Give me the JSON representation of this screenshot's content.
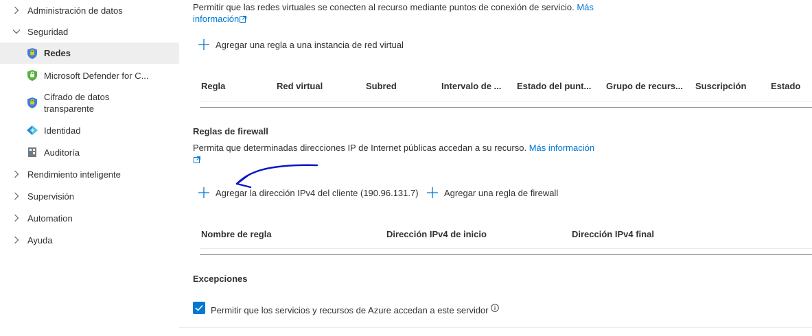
{
  "sidebar": {
    "items": [
      {
        "label": "Administración de datos"
      },
      {
        "label": "Seguridad"
      },
      {
        "label": "Redes"
      },
      {
        "label": "Microsoft Defender for C..."
      },
      {
        "label_line1": "Cifrado de datos",
        "label_line2": "transparente"
      },
      {
        "label": "Identidad"
      },
      {
        "label": "Auditoría"
      },
      {
        "label": "Rendimiento inteligente"
      },
      {
        "label": "Supervisión"
      },
      {
        "label": "Automation"
      },
      {
        "label": "Ayuda"
      }
    ],
    "icons": {
      "chevron_right": "chevron-right-icon",
      "chevron_down": "chevron-down-icon",
      "shield": "shield-icon",
      "defender": "defender-shield-icon",
      "identity": "identity-diamond-icon",
      "audit": "audit-building-icon"
    }
  },
  "vnet": {
    "description": "Permitir que las redes virtuales se conecten al recurso mediante puntos de conexión de servicio.",
    "more_info_1": "Más",
    "more_info_2": "información",
    "add_label": "Agregar una regla a una instancia de red virtual",
    "columns": [
      "Regla",
      "Red virtual",
      "Subred",
      "Intervalo de ...",
      "Estado del punt...",
      "Grupo de recurs...",
      "Suscripción",
      "Estado"
    ]
  },
  "firewall": {
    "title": "Reglas de firewall",
    "description": "Permita que determinadas direcciones IP de Internet públicas accedan a su recurso.",
    "more_info": "Más información",
    "add_client_label": "Agregar la dirección IPv4 del cliente (190.96.131.7)",
    "add_rule_label": "Agregar una regla de firewall",
    "columns": [
      "Nombre de regla",
      "Dirección IPv4 de inicio",
      "Dirección IPv4 final"
    ]
  },
  "exceptions": {
    "title": "Excepciones",
    "allow_azure_label": "Permitir que los servicios y recursos de Azure accedan a este servidor",
    "allow_azure_checked": true
  },
  "colors": {
    "accent": "#0078d4",
    "annotation": "#0a14c8",
    "selected_bg": "#eeeeee"
  }
}
